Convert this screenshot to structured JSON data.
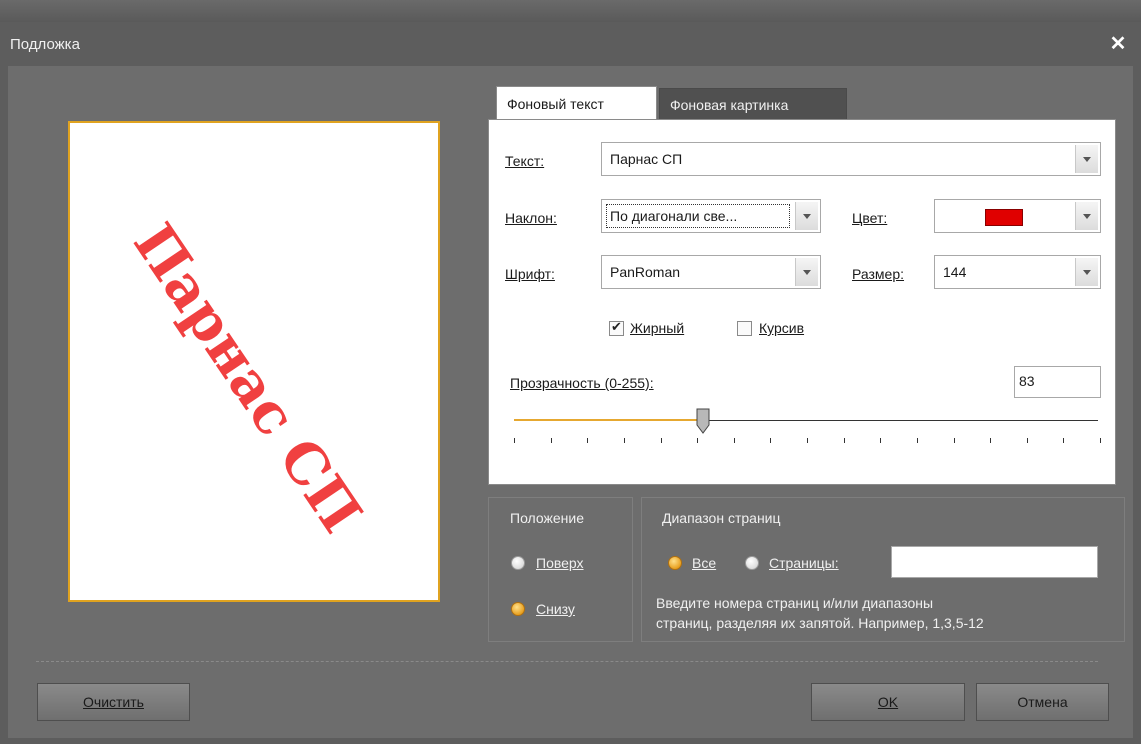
{
  "window": {
    "title": "Подложка",
    "close_glyph": "✕"
  },
  "preview": {
    "watermark_text": "Парнас СП",
    "watermark_color": "#f04040"
  },
  "tabs": [
    {
      "label": "Фоновый текст",
      "active": true
    },
    {
      "label": "Фоновая картинка",
      "active": false
    }
  ],
  "form": {
    "text_label": "Текст:",
    "text_value": "Парнас СП",
    "tilt_label": "Наклон:",
    "tilt_value": "По диагонали све...",
    "color_label": "Цвет:",
    "color_value": "#e00000",
    "font_label": "Шрифт:",
    "font_value": "PanRoman",
    "size_label": "Размер:",
    "size_value": "144",
    "bold_label": "Жирный",
    "bold_checked": true,
    "italic_label": "Курсив",
    "italic_checked": false,
    "opacity_label": "Прозрачность (0-255):",
    "opacity_value": "83",
    "opacity_slider_fraction": 0.325
  },
  "position_group": {
    "title": "Положение",
    "options": [
      {
        "label": "Поверх",
        "selected": false
      },
      {
        "label": "Снизу",
        "selected": true
      }
    ]
  },
  "range_group": {
    "title": "Диапазон страниц",
    "all_label": "Все",
    "all_selected": true,
    "pages_label": "Страницы:",
    "pages_selected": false,
    "pages_value": "",
    "hint_line1": "Введите номера страниц и/или диапазоны",
    "hint_line2": "страниц, разделяя их запятой. Например, 1,3,5-12"
  },
  "buttons": {
    "clear": "Очистить",
    "ok": "OK",
    "cancel": "Отмена"
  }
}
